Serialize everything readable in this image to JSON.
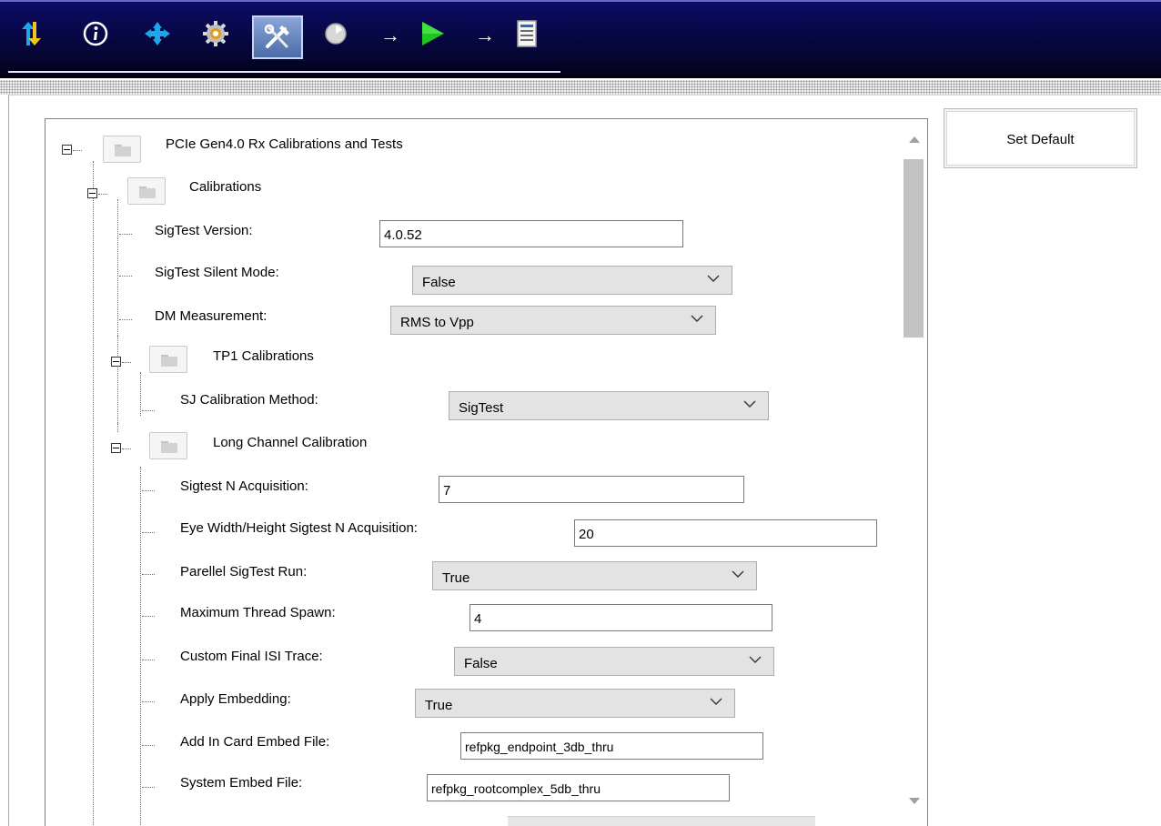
{
  "toolbar": {
    "icons": [
      "transfer-arrows-icon",
      "info-icon",
      "connection-icon",
      "settings-gear-icon",
      "tools-icon",
      "pointer-icon",
      "run-icon",
      "report-icon"
    ],
    "colors": {
      "background": "#08084c",
      "selected": "#5e7cb6",
      "run": "#1fc41f"
    }
  },
  "tree": {
    "root": {
      "label": "PCIe Gen4.0 Rx Calibrations and Tests"
    },
    "calibrations": {
      "label": "Calibrations"
    },
    "params": {
      "sigtest_version": {
        "label": "SigTest Version:",
        "value": "4.0.52"
      },
      "sigtest_silent_mode": {
        "label": "SigTest Silent Mode:",
        "value": "False"
      },
      "dm_measurement": {
        "label": "DM Measurement:",
        "value": "RMS to Vpp"
      }
    },
    "tp1": {
      "label": "TP1 Calibrations",
      "sj_method": {
        "label": "SJ Calibration Method:",
        "value": "SigTest"
      }
    },
    "long_channel": {
      "label": "Long Channel Calibration",
      "items": [
        {
          "label": "Sigtest N Acquisition:",
          "value": "7"
        },
        {
          "label": "Eye Width/Height Sigtest N Acquisition:",
          "value": "20"
        },
        {
          "label": "Parellel SigTest Run:",
          "value": "True"
        },
        {
          "label": "Maximum Thread Spawn:",
          "value": "4"
        },
        {
          "label": "Custom Final ISI Trace:",
          "value": "False"
        },
        {
          "label": "Apply Embedding:",
          "value": "True"
        },
        {
          "label": "Add In Card Embed File:",
          "value": "refpkg_endpoint_3db_thru"
        },
        {
          "label": "System Embed File:",
          "value": "refpkg_rootcomplex_5db_thru"
        }
      ]
    }
  },
  "buttons": {
    "set_default": "Set Default"
  }
}
